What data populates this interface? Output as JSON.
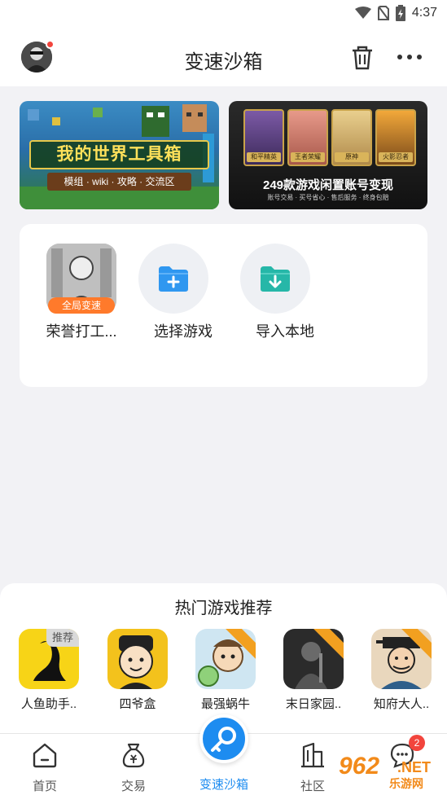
{
  "status_bar": {
    "time": "4:37"
  },
  "header": {
    "title": "变速沙箱"
  },
  "banners": {
    "minecraft": {
      "title": "我的世界工具箱",
      "subtitle": "模组 · wiki · 攻略 · 交流区"
    },
    "account": {
      "cards": [
        "和平精英",
        "王者荣耀",
        "原神",
        "火影忍者"
      ],
      "title": "249款游戏闲置账号变现",
      "subtitle": "账号交易 · 买号省心 · 售后服务 · 终身包赔"
    }
  },
  "sandbox": {
    "apps": [
      {
        "label": "荣誉打工...",
        "badge": "全局变速"
      },
      {
        "label": "选择游戏"
      },
      {
        "label": "导入本地"
      }
    ]
  },
  "hot": {
    "title": "热门游戏推荐",
    "games": [
      {
        "label": "人鱼助手..",
        "tag": "推荐"
      },
      {
        "label": "四爷盒"
      },
      {
        "label": "最强蜗牛"
      },
      {
        "label": "末日家园.."
      },
      {
        "label": "知府大人.."
      }
    ]
  },
  "nav": {
    "items": [
      "首页",
      "交易",
      "变速沙箱",
      "社区"
    ],
    "message_badge": "2"
  },
  "watermark": {
    "number": "962",
    "net": ".NET",
    "sub": "乐游网"
  },
  "colors": {
    "accent": "#1d8cf0",
    "badge": "#f2453d",
    "speed_badge": "#ff7a2b"
  }
}
